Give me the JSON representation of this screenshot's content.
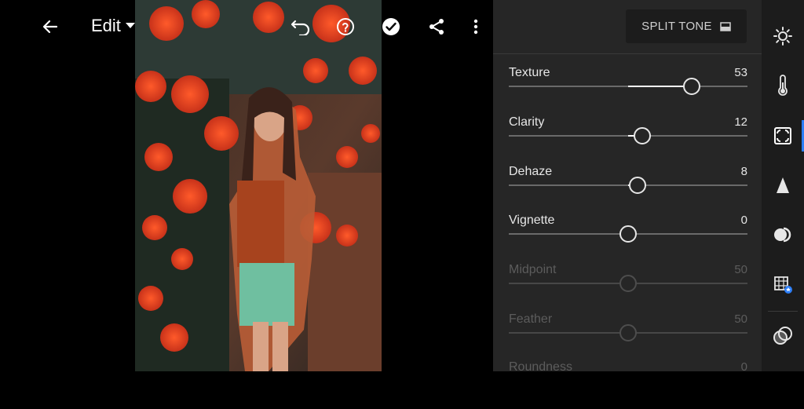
{
  "toolbar": {
    "edit_label": "Edit"
  },
  "panel": {
    "mode_button_label": "SPLIT TONE",
    "sliders": [
      {
        "label": "Texture",
        "value": "53",
        "level": 53,
        "enabled": true
      },
      {
        "label": "Clarity",
        "value": "12",
        "level": 12,
        "enabled": true
      },
      {
        "label": "Dehaze",
        "value": "8",
        "level": 8,
        "enabled": true
      },
      {
        "label": "Vignette",
        "value": "0",
        "level": 0,
        "enabled": true
      },
      {
        "label": "Midpoint",
        "value": "50",
        "level": 0,
        "enabled": false
      },
      {
        "label": "Feather",
        "value": "50",
        "level": 0,
        "enabled": false
      },
      {
        "label": "Roundness",
        "value": "0",
        "level": 0,
        "enabled": false
      }
    ]
  },
  "rail": {
    "items": [
      "light-icon",
      "color-temperature-icon",
      "effects-icon",
      "detail-icon",
      "optics-icon",
      "geometry-icon",
      "presets-icon"
    ],
    "active_index": 2
  },
  "colors": {
    "panel_bg": "#262626",
    "rail_bg": "#1c1c1c",
    "accent": "#2d7ff9"
  }
}
